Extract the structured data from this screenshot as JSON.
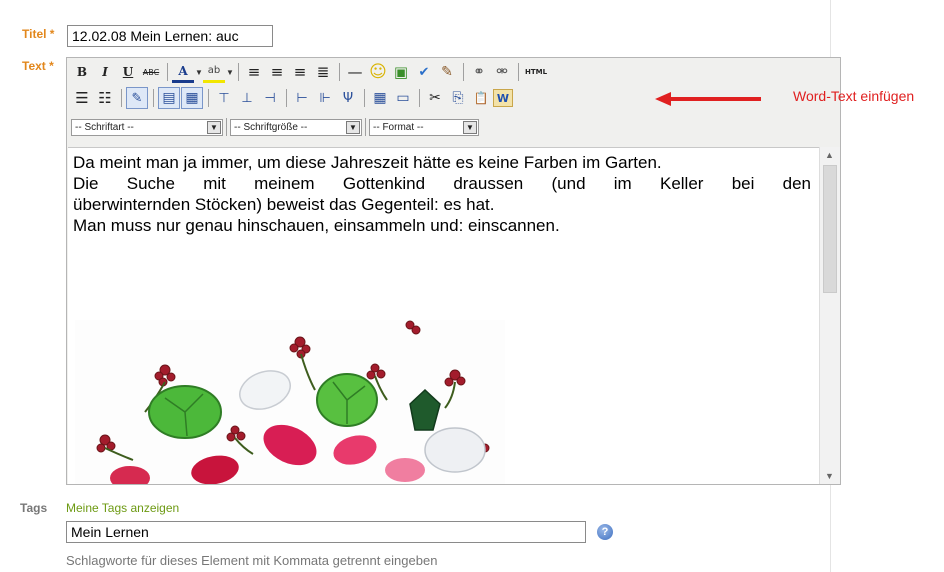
{
  "form": {
    "title_label": "Titel",
    "text_label": "Text",
    "required_mark": "*",
    "title_value": "12.02.08 Mein Lernen: auc"
  },
  "toolbar": {
    "row1": [
      {
        "icon": "bold-icon",
        "glyph": "B"
      },
      {
        "icon": "italic-icon",
        "glyph": "I"
      },
      {
        "icon": "underline-icon",
        "glyph": "U"
      },
      {
        "icon": "strikethrough-icon",
        "glyph": "ABC"
      },
      {
        "icon": "font-color-icon",
        "glyph": "A"
      },
      {
        "icon": "highlight-color-icon",
        "glyph": "ab"
      },
      {
        "icon": "align-left-icon",
        "glyph": "≡"
      },
      {
        "icon": "align-center-icon",
        "glyph": "≡"
      },
      {
        "icon": "align-right-icon",
        "glyph": "≡"
      },
      {
        "icon": "justify-icon",
        "glyph": "≣"
      },
      {
        "icon": "horizontal-rule-icon",
        "glyph": "—"
      },
      {
        "icon": "smiley-icon",
        "glyph": "☺"
      },
      {
        "icon": "insert-image-icon",
        "glyph": "▣"
      },
      {
        "icon": "spellcheck-icon",
        "glyph": "✔"
      },
      {
        "icon": "cleanup-icon",
        "glyph": "✎"
      },
      {
        "icon": "link-icon",
        "glyph": "⚭"
      },
      {
        "icon": "unlink-icon",
        "glyph": "⚮"
      },
      {
        "icon": "html-source-icon",
        "glyph": "HTML"
      }
    ],
    "row2": [
      {
        "icon": "bullet-list-icon",
        "glyph": "☰"
      },
      {
        "icon": "numbered-list-icon",
        "glyph": "☷"
      },
      {
        "icon": "edit-mode-icon",
        "glyph": "✎"
      },
      {
        "icon": "table-toggle-icon",
        "glyph": "▤"
      },
      {
        "icon": "table-props-icon",
        "glyph": "▦"
      },
      {
        "icon": "row-before-icon",
        "glyph": "⊤"
      },
      {
        "icon": "row-after-icon",
        "glyph": "⊥"
      },
      {
        "icon": "delete-row-icon",
        "glyph": "⊣"
      },
      {
        "icon": "col-before-icon",
        "glyph": "⊢"
      },
      {
        "icon": "col-after-icon",
        "glyph": "⊩"
      },
      {
        "icon": "delete-col-icon",
        "glyph": "Ψ"
      },
      {
        "icon": "insert-table-icon",
        "glyph": "▦"
      },
      {
        "icon": "merge-cells-icon",
        "glyph": "▭"
      },
      {
        "icon": "cut-icon",
        "glyph": "✂"
      },
      {
        "icon": "copy-icon",
        "glyph": "⎘"
      },
      {
        "icon": "paste-icon",
        "glyph": "📋"
      },
      {
        "icon": "paste-word-icon",
        "glyph": "W"
      }
    ],
    "font_select": "-- Schriftart --",
    "size_select": "-- Schriftgröße --",
    "format_select": "-- Format --"
  },
  "editor": {
    "line1": "Da meint man ja immer, um diese Jahreszeit hätte es keine Farben im Garten.",
    "line2": "Die Suche mit meinem Gottenkind draussen (und im Keller bei den",
    "line3": "überwinternden Stöcken) beweist das Gegenteil: es hat.",
    "line4": "Man muss nur genau hinschauen, einsammeln und: einscannen."
  },
  "annotation": {
    "label": "Word-Text einfügen",
    "color": "#e02020"
  },
  "tags": {
    "label": "Tags",
    "show_link": "Meine Tags anzeigen",
    "value": "Mein Lernen",
    "hint": "Schlagworte für dieses Element mit Kommata getrennt eingeben",
    "help_glyph": "?"
  }
}
